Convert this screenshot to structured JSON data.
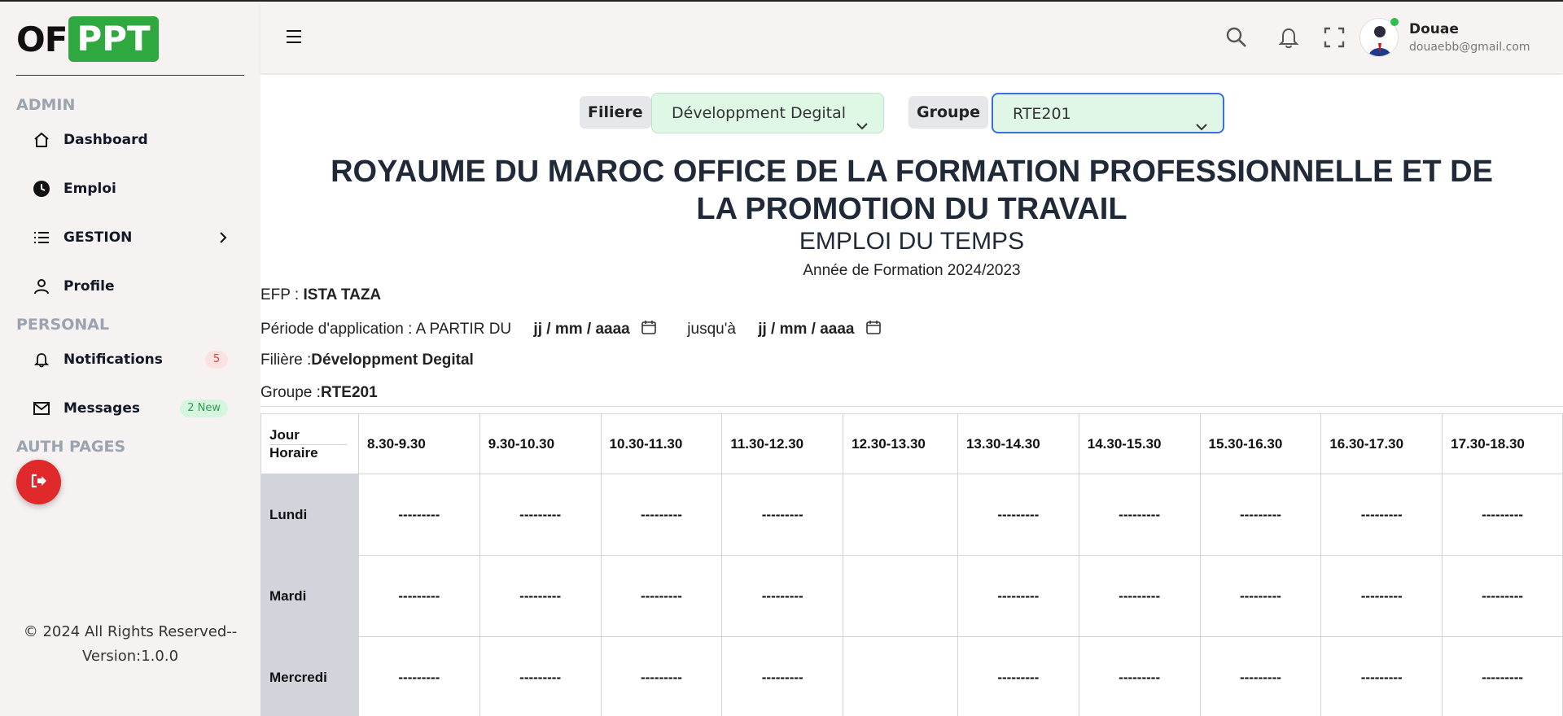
{
  "logo": {
    "part1": "OF",
    "part2": "PPT"
  },
  "sidebar": {
    "admin_title": "ADMIN",
    "personal_title": "PERSONAL",
    "auth_title": "AUTH PAGES",
    "items": [
      {
        "label": "Dashboard"
      },
      {
        "label": "Emploi"
      },
      {
        "label": "GESTION"
      },
      {
        "label": "Profile"
      },
      {
        "label": "Notifications",
        "badge": "5"
      },
      {
        "label": "Messages",
        "badge": "2 New"
      }
    ],
    "footer_line1": "© 2024 All Rights Reserved--",
    "footer_line2": "Version:1.0.0"
  },
  "header": {
    "user_name": "Douae",
    "user_email": "douaebb@gmail.com"
  },
  "filters": {
    "filiere_label": "Filiere",
    "filiere_value": "Développment Degital",
    "groupe_label": "Groupe",
    "groupe_value": "RTE201"
  },
  "document": {
    "title": "ROYAUME DU MAROC OFFICE DE LA FORMATION PROFESSIONNELLE ET DE LA PROMOTION DU TRAVAIL",
    "subtitle": "EMPLOI DU TEMPS",
    "year": "Année de Formation 2024/2023",
    "efp_label": "EFP : ",
    "efp_value": "ISTA TAZA",
    "periode_label": "Période d'application : A PARTIR DU",
    "date_placeholder": "jj / mm / aaaa",
    "jusqua": "jusqu'à",
    "filiere_label": "Filière :",
    "filiere_value": "Développment Degital",
    "groupe_label": "Groupe :",
    "groupe_value": "RTE201"
  },
  "timetable": {
    "corner_line1": "Jour",
    "corner_line2": "Horaire",
    "slots": [
      "8.30-9.30",
      "9.30-10.30",
      "10.30-11.30",
      "11.30-12.30",
      "12.30-13.30",
      "13.30-14.30",
      "14.30-15.30",
      "15.30-16.30",
      "16.30-17.30",
      "17.30-18.30"
    ],
    "rows": [
      {
        "day": "Lundi",
        "cells": [
          "---------",
          "---------",
          "---------",
          "---------",
          "",
          "---------",
          "---------",
          "---------",
          "---------",
          "---------"
        ]
      },
      {
        "day": "Mardi",
        "cells": [
          "---------",
          "---------",
          "---------",
          "---------",
          "",
          "---------",
          "---------",
          "---------",
          "---------",
          "---------"
        ]
      },
      {
        "day": "Mercredi",
        "cells": [
          "---------",
          "---------",
          "---------",
          "---------",
          "",
          "---------",
          "---------",
          "---------",
          "---------",
          "---------"
        ]
      }
    ]
  }
}
